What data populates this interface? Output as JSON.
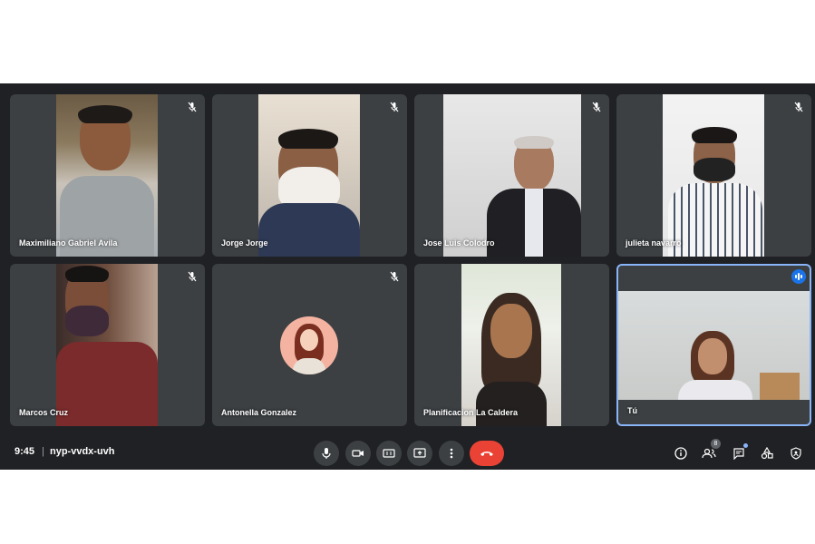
{
  "participants": [
    {
      "name": "Maximiliano Gabriel Avila",
      "muted": true
    },
    {
      "name": "Jorge Jorge",
      "muted": true
    },
    {
      "name": "Jose Luis Colodro",
      "muted": true
    },
    {
      "name": "julieta navarro",
      "muted": true
    },
    {
      "name": "Marcos Cruz",
      "muted": true
    },
    {
      "name": "Antonella Gonzalez",
      "muted": true
    },
    {
      "name": "Planificacion La Caldera",
      "muted": false
    },
    {
      "name": "Tú",
      "muted": false,
      "speaking": true
    }
  ],
  "bottom_bar": {
    "time": "9:45",
    "separator": "|",
    "meeting_code": "nyp-vvdx-uvh",
    "participant_count": "8",
    "controls": [
      "microphone-icon",
      "camera-icon",
      "captions-icon",
      "present-screen-icon",
      "more-options-icon",
      "end-call-icon"
    ],
    "right_icons": [
      "info-icon",
      "people-icon",
      "chat-icon",
      "activities-icon",
      "host-controls-icon"
    ]
  },
  "colors": {
    "background": "#202124",
    "tile": "#3c4043",
    "end_call": "#ea4335",
    "active_border": "#8ab4f8",
    "speaking": "#1a73e8"
  }
}
